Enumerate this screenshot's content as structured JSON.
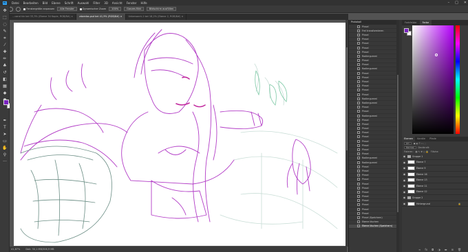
{
  "menu": [
    "Datei",
    "Bearbeiten",
    "Bild",
    "Ebene",
    "Schrift",
    "Auswahl",
    "Filter",
    "3D",
    "Ansicht",
    "Fenster",
    "Hilfe"
  ],
  "options": {
    "check1": "Fenstergröße anpassen",
    "btn1": "Alle Fenster",
    "check2": "Dynamischer Zoom",
    "btn2": "100%",
    "btn3": "Ganzes Bild",
    "btn4": "Bildschirm ausfüllen"
  },
  "tabs": [
    {
      "label": "...cand kin bei 33,3% (Ebene 34 Kopie, RGB/8#) ×",
      "active": false
    },
    {
      "label": "zdaedas.psd bei 41,9% (RGB/8#) ×",
      "active": true
    },
    {
      "label": "Unbenannt-1 bei 18,2% (Ebene 2, RGB/8#) ×",
      "active": false
    }
  ],
  "status": {
    "zoom": "41,87%",
    "doc": "Dok: 30,1 MB/306,9 MB"
  },
  "history": {
    "title": "Protokoll",
    "items": [
      "Pinsel",
      "Frei transformieren",
      "Pinsel",
      "Pinsel",
      "Pinsel",
      "Pinsel",
      "Pinsel",
      "Radiergummi",
      "Pinsel",
      "Pinsel",
      "Radiergummi",
      "Pinsel",
      "Pinsel",
      "Pinsel",
      "Pinsel",
      "Pinsel",
      "Pinsel",
      "Radiergummi",
      "Radiergummi",
      "Pinsel",
      "Pinsel",
      "Radiergummi",
      "Pinsel",
      "Pinsel",
      "Pinsel",
      "Pinsel",
      "Pinsel",
      "Pinsel",
      "Pinsel",
      "Pinsel",
      "Pinsel",
      "Radiergummi",
      "Radiergummi",
      "Pinsel",
      "Pinsel",
      "Pinsel",
      "Pinsel",
      "Pinsel",
      "Pinsel",
      "Pinsel",
      "Pinsel",
      "Pinsel",
      "Pinsel",
      "Pinsel",
      "Pinsel",
      "Pinsel (Speichern)",
      "Ebene löschen",
      "Ebene löschen (Speichern)"
    ],
    "selected_index": 47
  },
  "color": {
    "tabs": [
      "Farbfelder",
      "Farbe"
    ],
    "active_tab": 1,
    "foreground": "#7a22c0",
    "background": "#ffffff"
  },
  "layers": {
    "tabs": [
      "Ebenen",
      "Kanäle",
      "Pfade"
    ],
    "filter": "Art",
    "blend": "Normal",
    "opacity_label": "Deckkraft:",
    "fill_label": "Fläche:",
    "lock_label": "Fixieren:",
    "rows": [
      {
        "name": "Gruppe 1",
        "type": "group"
      },
      {
        "name": "Ebene 7",
        "type": "layer"
      },
      {
        "name": "Ebene 9",
        "type": "layer"
      },
      {
        "name": "Ebene 16",
        "type": "layer"
      },
      {
        "name": "Ebene 13",
        "type": "layer"
      },
      {
        "name": "Ebene 11",
        "type": "layer"
      },
      {
        "name": "Ebene 12",
        "type": "layer"
      },
      {
        "name": "Gruppe 2",
        "type": "group"
      },
      {
        "name": "Hintergrund",
        "type": "background"
      }
    ]
  }
}
